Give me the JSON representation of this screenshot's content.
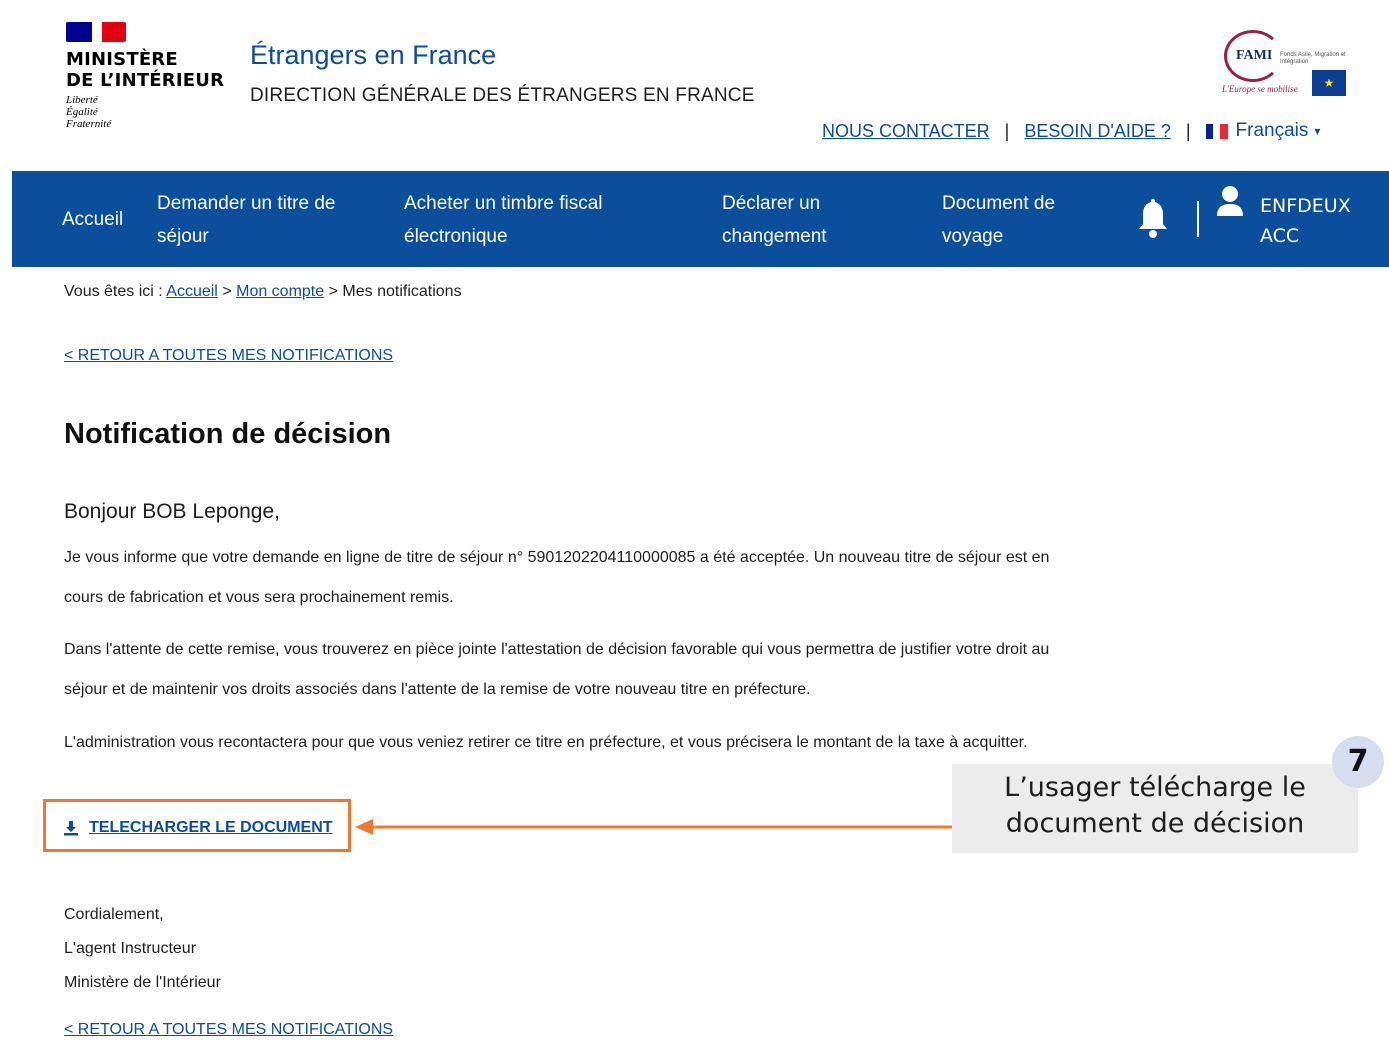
{
  "header": {
    "ministry": {
      "line1": "MINISTÈRE",
      "line2": "DE L’INTÉRIEUR",
      "motto": [
        "Liberté",
        "Égalité",
        "Fraternité"
      ]
    },
    "site_title": "Étrangers en France",
    "site_subtitle": "DIRECTION GÉNÉRALE DES ÉTRANGERS EN FRANCE",
    "fami": {
      "name": "FAMI",
      "subtitle": "Fonds Asile, Migration et Intégration",
      "slogan": "L'Europe se mobilise"
    },
    "links": {
      "contact": "NOUS CONTACTER",
      "help": "BESOIN D'AIDE ?",
      "separator": "|",
      "language": "Français"
    }
  },
  "nav": {
    "items": [
      {
        "label": "Accueil"
      },
      {
        "label": "Demander un titre de séjour"
      },
      {
        "label": "Acheter un timbre fiscal électronique"
      },
      {
        "label": "Déclarer un changement"
      },
      {
        "label": "Document de voyage"
      }
    ],
    "user": {
      "line1": "ENFDEUX",
      "line2": "ACC"
    }
  },
  "breadcrumb": {
    "prefix": "Vous êtes ici :",
    "home": "Accueil",
    "sep": ">",
    "account": "Mon compte",
    "current": "Mes notifications"
  },
  "back_link": "< RETOUR A TOUTES MES NOTIFICATIONS",
  "notification": {
    "title": "Notification de décision",
    "greeting": "Bonjour BOB Leponge,",
    "paragraphs": [
      "Je vous informe que votre demande en ligne de titre de séjour n° 5901202204110000085 a été acceptée. Un nouveau titre de séjour est en cours de fabrication et vous sera prochainement remis.",
      "Dans l'attente de cette remise, vous trouverez en pièce jointe l'attestation de décision favorable qui vous permettra de justifier votre droit au séjour et de maintenir vos droits associés dans l'attente de la remise de votre nouveau titre en préfecture.",
      "L'administration vous recontactera pour que vous veniez retirer ce titre en préfecture, et vous précisera le montant de la taxe à acquitter."
    ],
    "download_label": "TELECHARGER LE DOCUMENT",
    "closing": [
      "Cordialement,",
      "L'agent Instructeur",
      "Ministère de l'Intérieur"
    ]
  },
  "annotation": {
    "step": "7",
    "text": "L’usager télécharge le document de décision"
  },
  "colors": {
    "nav_bg": "#0a4e9c",
    "link": "#0a4d9c",
    "highlight": "#ee7a2f",
    "callout_bg": "#ececec",
    "badge_bg": "#d6ddf0"
  },
  "icons": {
    "bell": "bell-icon",
    "user": "user-icon",
    "download": "download-icon",
    "flag": "french-flag-icon"
  }
}
